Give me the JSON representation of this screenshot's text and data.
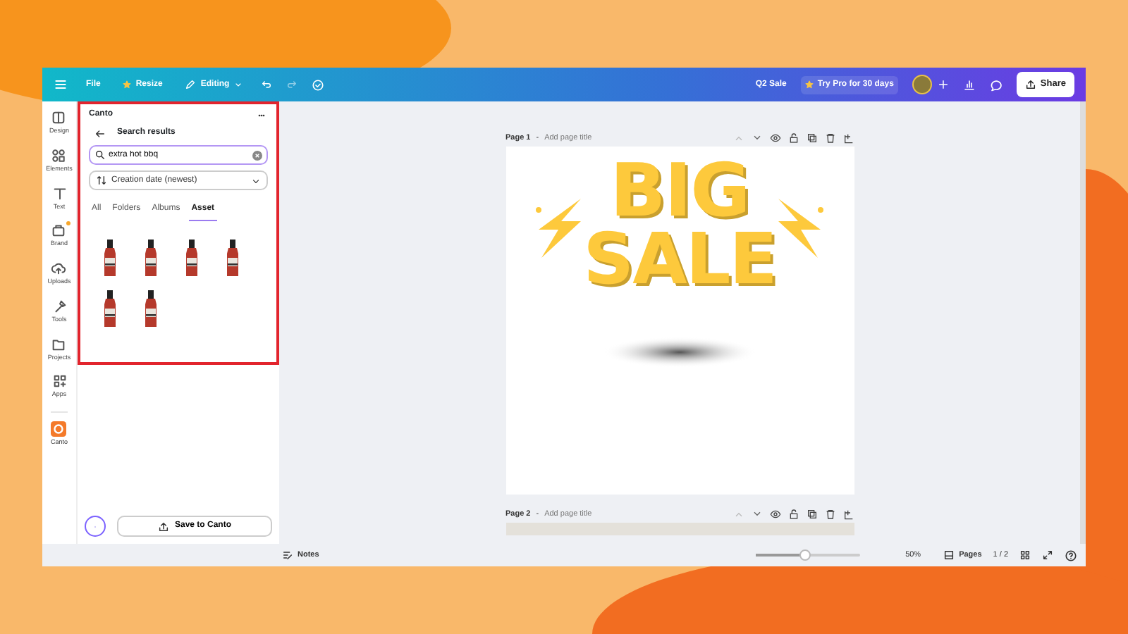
{
  "topbar": {
    "file": "File",
    "resize": "Resize",
    "editing": "Editing",
    "design_title": "Q2 Sale",
    "pro": "Try Pro for 30 days",
    "share": "Share"
  },
  "rail": [
    {
      "label": "Design",
      "selected": false,
      "badge": false
    },
    {
      "label": "Elements",
      "selected": false,
      "badge": false
    },
    {
      "label": "Text",
      "selected": false,
      "badge": false
    },
    {
      "label": "Brand",
      "selected": false,
      "badge": true
    },
    {
      "label": "Uploads",
      "selected": false,
      "badge": false
    },
    {
      "label": "Tools",
      "selected": false,
      "badge": false
    },
    {
      "label": "Projects",
      "selected": false,
      "badge": false
    },
    {
      "label": "Apps",
      "selected": false,
      "badge": false
    },
    {
      "label": "Canto",
      "selected": true,
      "badge": false
    }
  ],
  "panel": {
    "title": "Canto",
    "heading": "Search results",
    "search": {
      "value": "extra hot bbq"
    },
    "sort": "Creation date (newest)",
    "tabs": [
      {
        "label": "All",
        "selected": false
      },
      {
        "label": "Folders",
        "selected": false
      },
      {
        "label": "Albums",
        "selected": false
      },
      {
        "label": "Asset",
        "selected": true
      }
    ],
    "results": [
      {
        "kind": "image"
      },
      {
        "kind": "image"
      },
      {
        "kind": "image"
      },
      {
        "kind": "image"
      },
      {
        "kind": "image"
      },
      {
        "kind": "image"
      }
    ],
    "save": "Save to Canto"
  },
  "pages": [
    {
      "label": "Page 1",
      "separator": "-",
      "title_placeholder": "Add page title",
      "artwork": [
        "BIG",
        "SALE"
      ]
    },
    {
      "label": "Page 2",
      "separator": "-",
      "title_placeholder": "Add page title"
    }
  ],
  "bottombar": {
    "notes": "Notes",
    "zoom": {
      "level": 0.47,
      "reading": "50%"
    },
    "pages": "Pages",
    "count": "1 / 2"
  }
}
